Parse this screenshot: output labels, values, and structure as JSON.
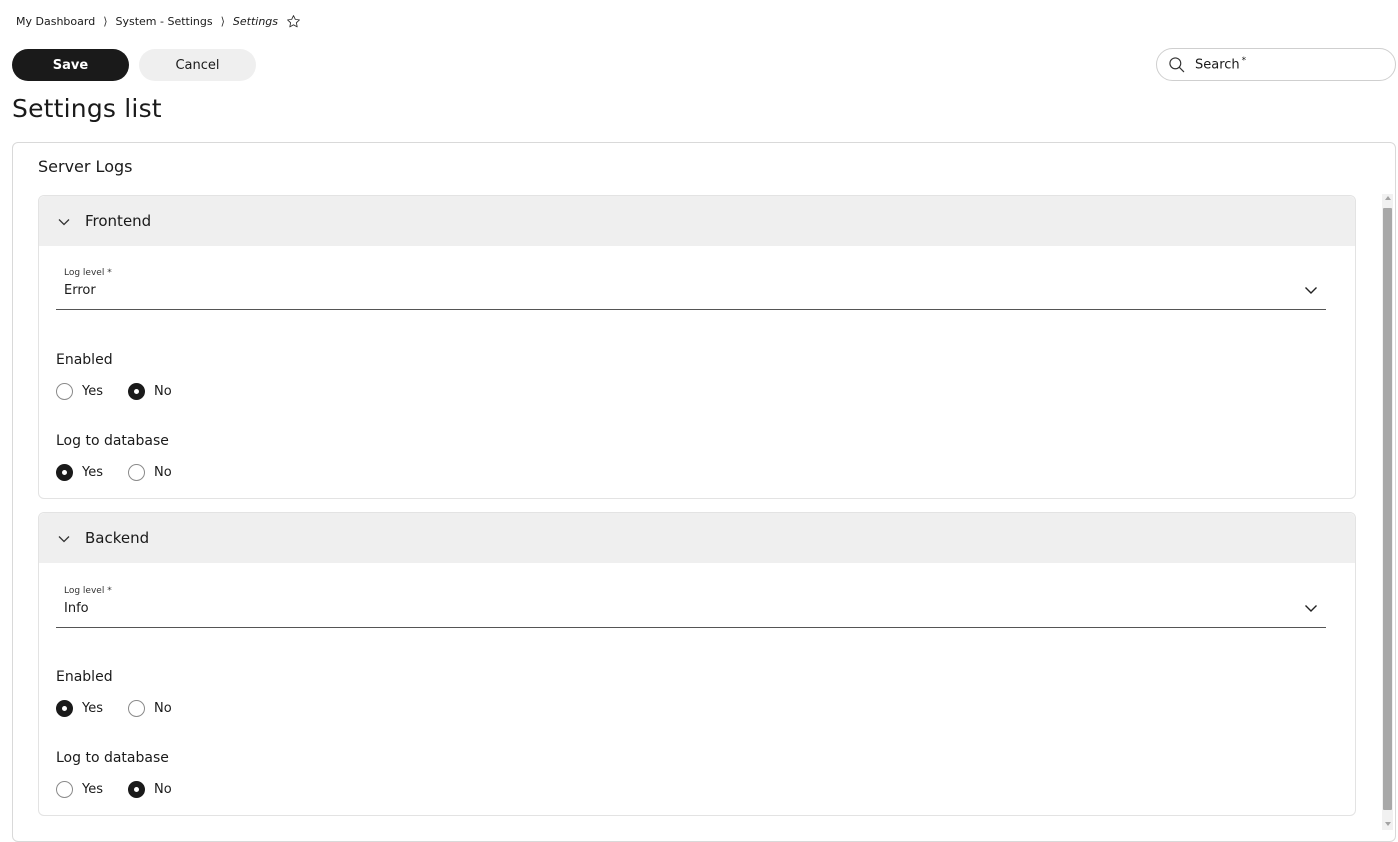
{
  "breadcrumb": {
    "items": [
      "My Dashboard",
      "System - Settings"
    ],
    "separator": "⟩",
    "current": "Settings"
  },
  "toolbar": {
    "save_label": "Save",
    "cancel_label": "Cancel"
  },
  "search": {
    "label": "Search",
    "required_mark": "*"
  },
  "page_title": "Settings list",
  "card": {
    "title": "Server Logs",
    "sections": [
      {
        "title": "Frontend",
        "log_level_label": "Log level",
        "log_level_required": "*",
        "log_level_value": "Error",
        "enabled_label": "Enabled",
        "enabled_options": [
          "Yes",
          "No"
        ],
        "enabled_selected": "No",
        "log_db_label": "Log to database",
        "log_db_options": [
          "Yes",
          "No"
        ],
        "log_db_selected": "Yes"
      },
      {
        "title": "Backend",
        "log_level_label": "Log level",
        "log_level_required": "*",
        "log_level_value": "Info",
        "enabled_label": "Enabled",
        "enabled_options": [
          "Yes",
          "No"
        ],
        "enabled_selected": "Yes",
        "log_db_label": "Log to database",
        "log_db_options": [
          "Yes",
          "No"
        ],
        "log_db_selected": "No"
      }
    ]
  },
  "colors": {
    "primary": "#1a1a1a",
    "secondary_button": "#efefef",
    "section_header": "#efefef"
  }
}
